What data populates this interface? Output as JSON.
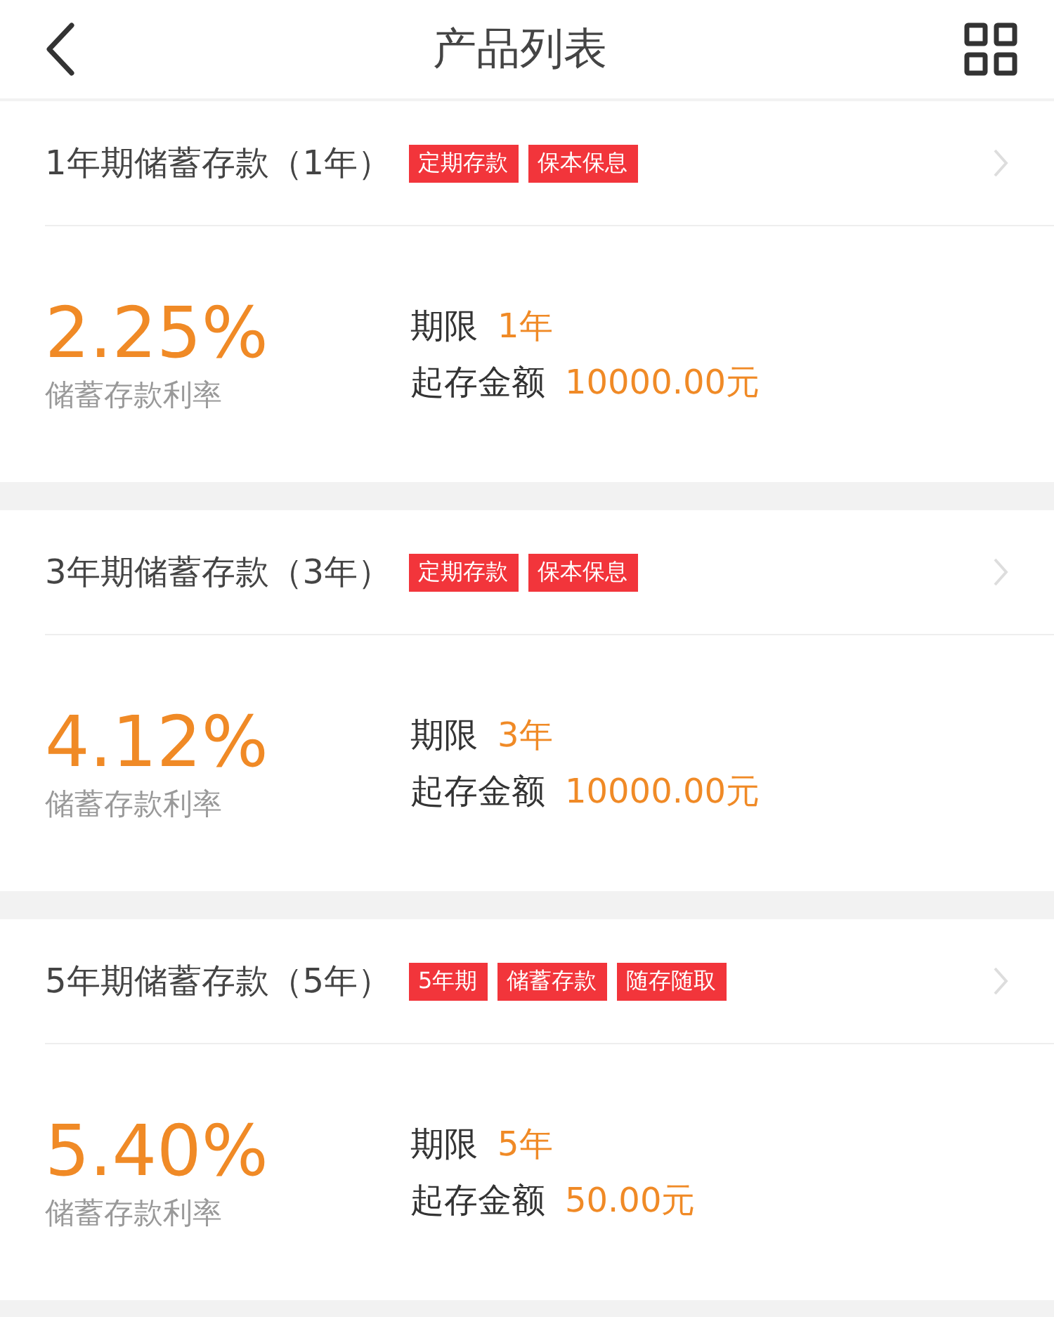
{
  "header": {
    "title": "产品列表"
  },
  "products": [
    {
      "title": "1年期储蓄存款（1年）",
      "tags": [
        "定期存款",
        "保本保息"
      ],
      "rate": "2.25%",
      "rate_label": "储蓄存款利率",
      "term_label": "期限",
      "term": "1年",
      "min_label": "起存金额",
      "min_amount": "10000.00元"
    },
    {
      "title": "3年期储蓄存款（3年）",
      "tags": [
        "定期存款",
        "保本保息"
      ],
      "rate": "4.12%",
      "rate_label": "储蓄存款利率",
      "term_label": "期限",
      "term": "3年",
      "min_label": "起存金额",
      "min_amount": "10000.00元"
    },
    {
      "title": "5年期储蓄存款（5年）",
      "tags": [
        "5年期",
        "储蓄存款",
        "随存随取"
      ],
      "rate": "5.40%",
      "rate_label": "储蓄存款利率",
      "term_label": "期限",
      "term": "5年",
      "min_label": "起存金额",
      "min_amount": "50.00元"
    }
  ]
}
